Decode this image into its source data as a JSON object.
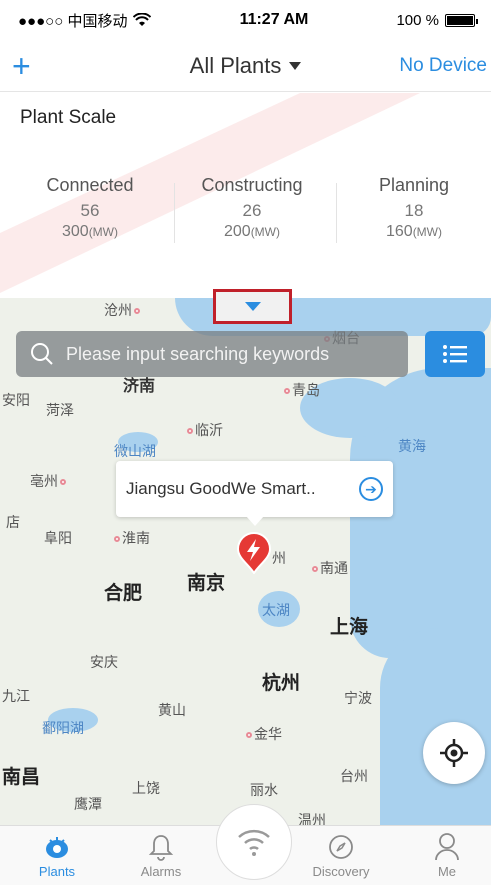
{
  "status_bar": {
    "carrier": "●●●○○ 中国移动",
    "time": "11:27 AM",
    "battery": "100 %"
  },
  "nav": {
    "add_label": "+",
    "title": "All Plants",
    "right_label": "No Device"
  },
  "plant_scale": {
    "title": "Plant Scale",
    "stats": [
      {
        "label": "Connected",
        "count": "56",
        "capacity": "300",
        "unit": "(MW)"
      },
      {
        "label": "Constructing",
        "count": "26",
        "capacity": "200",
        "unit": "(MW)"
      },
      {
        "label": "Planning",
        "count": "18",
        "capacity": "160",
        "unit": "(MW)"
      }
    ]
  },
  "search": {
    "placeholder": "Please input searching keywords"
  },
  "map": {
    "labels": {
      "cangzhou": "沧州",
      "yantai": "烟台",
      "jinan": "济南",
      "qingdao": "青岛",
      "anyang": "安阳",
      "heze": "菏泽",
      "linyi": "临沂",
      "weishan_lake": "微山湖",
      "yellow_sea": "黄海",
      "bozhou": "亳州",
      "dian": "店",
      "fuyang": "阜阳",
      "huainan": "淮南",
      "nantong": "南通",
      "hefei": "合肥",
      "nanjing": "南京",
      "taihu": "太湖",
      "shanghai": "上海",
      "anqing": "安庆",
      "hangzhou": "杭州",
      "jiujiang": "九江",
      "huangshan": "黄山",
      "ningbo": "宁波",
      "poyang_lake": "鄱阳湖",
      "jinhua": "金华",
      "nanchang": "南昌",
      "shangrao": "上饶",
      "taizhou": "台州",
      "yingtan": "鹰潭",
      "lishui": "丽水",
      "wenzhou": "温州",
      "zhou": "州"
    },
    "callout": "Jiangsu GoodWe Smart.."
  },
  "tabs": [
    {
      "label": "Plants",
      "icon": "plant-icon"
    },
    {
      "label": "Alarms",
      "icon": "bell-icon"
    },
    {
      "label": "",
      "icon": "wifi-icon"
    },
    {
      "label": "Discovery",
      "icon": "compass-icon"
    },
    {
      "label": "Me",
      "icon": "person-icon"
    }
  ],
  "colors": {
    "accent": "#2b8de0",
    "highlight_box": "#c0202a",
    "pin": "#e53935"
  }
}
